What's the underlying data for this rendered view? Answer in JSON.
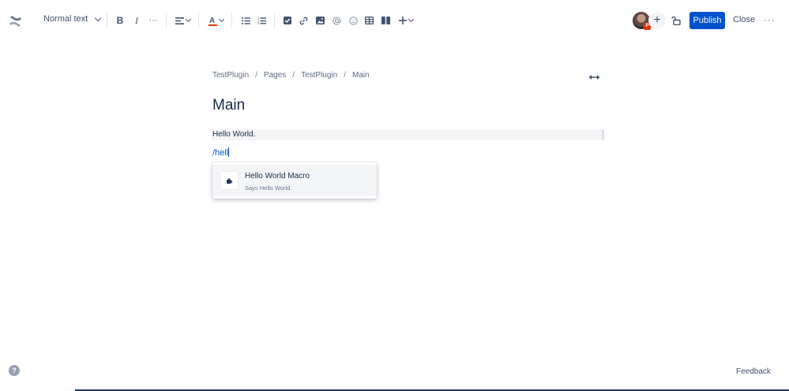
{
  "toolbar": {
    "text_style": "Normal text",
    "more_formatting": "···",
    "publish_label": "Publish",
    "close_label": "Close",
    "more_actions": "···",
    "invite_symbol": "+",
    "avatar_badge": "P"
  },
  "breadcrumb": [
    "TestPlugin",
    "/",
    "Pages",
    "/",
    "TestPlugin",
    "/",
    "Main"
  ],
  "page": {
    "title": "Main",
    "paragraph": "Hello World.",
    "slash_command": "/hell"
  },
  "typeahead": {
    "items": [
      {
        "title": "Hello World Macro",
        "description": "Says Hello World."
      }
    ]
  },
  "footer": {
    "help_symbol": "?",
    "feedback_label": "Feedback"
  },
  "colors": {
    "primary": "#0052cc",
    "text": "#172b4d",
    "subtle": "#42526e"
  }
}
